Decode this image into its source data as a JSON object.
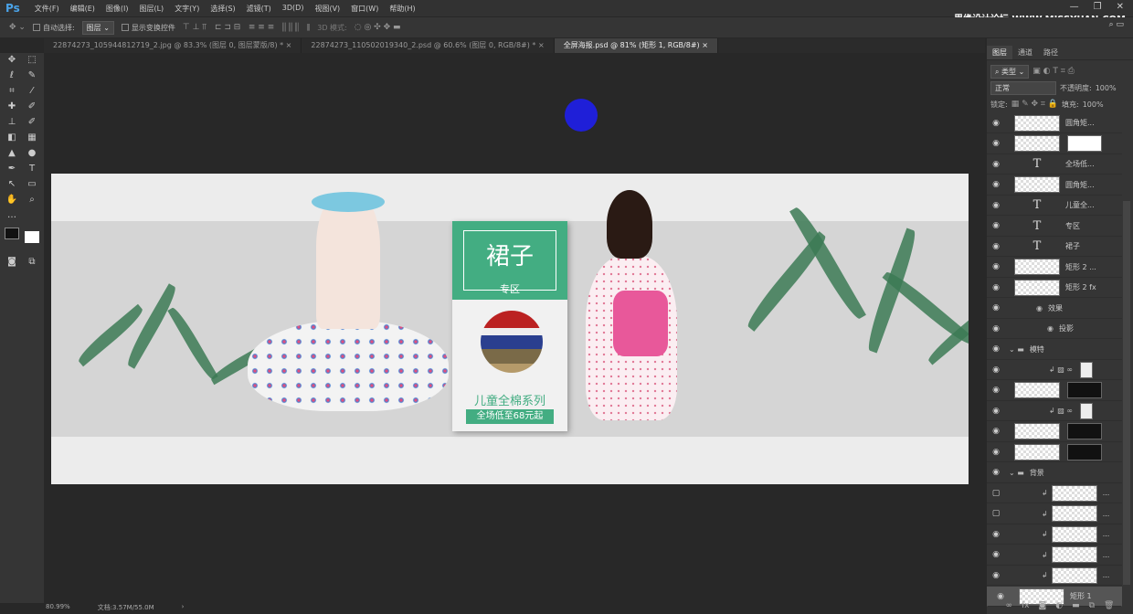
{
  "app": {
    "logo": "Ps",
    "watermark": "思缘设计论坛 WWW.MISSYUAN.COM",
    "window_controls": [
      "—",
      "❐",
      "✕"
    ]
  },
  "menu": [
    "文件(F)",
    "编辑(E)",
    "图像(I)",
    "图层(L)",
    "文字(Y)",
    "选择(S)",
    "滤镜(T)",
    "3D(D)",
    "视图(V)",
    "窗口(W)",
    "帮助(H)"
  ],
  "options": {
    "auto_select_label": "自动选择:",
    "auto_select_value": "图层",
    "show_transform_label": "显示变换控件",
    "mode3d_label": "3D 模式:"
  },
  "tabs": [
    {
      "label": "22874273_105944812719_2.jpg @ 83.3% (图层 0, 图层蒙版/8) *",
      "active": false
    },
    {
      "label": "22874273_110502019340_2.psd @ 60.6% (图层 0, RGB/8#) *",
      "active": false
    },
    {
      "label": "全屏海报.psd @ 81% (矩形 1, RGB/8#)",
      "active": true
    }
  ],
  "banner": {
    "card_title": "裙子",
    "card_subtitle": "专区",
    "series": "儿童全棉系列",
    "price": "全场低至68元起",
    "accent": "#43ad82"
  },
  "panel": {
    "tabs": [
      "图层",
      "通道",
      "路径"
    ],
    "filter_label": "类型",
    "blend_mode": "正常",
    "opacity_label": "不透明度:",
    "opacity": "100%",
    "lock_label": "锁定:",
    "fill_label": "填充:",
    "fill": "100%",
    "layers": [
      {
        "name": "圆角矩...",
        "kind": "smart",
        "visible": true
      },
      {
        "name": "",
        "kind": "mask",
        "visible": true
      },
      {
        "name": "全场低...",
        "kind": "text",
        "visible": true
      },
      {
        "name": "圆角矩...",
        "kind": "smart",
        "visible": true
      },
      {
        "name": "儿童全...",
        "kind": "text",
        "visible": true
      },
      {
        "name": "专区",
        "kind": "text",
        "visible": true
      },
      {
        "name": "裙子",
        "kind": "text",
        "visible": true
      },
      {
        "name": "矩形 2 ...",
        "kind": "smart",
        "visible": true
      },
      {
        "name": "矩形 2 fx",
        "kind": "smart",
        "visible": true
      },
      {
        "name": "效果",
        "kind": "effect",
        "visible": true
      },
      {
        "name": "投影",
        "kind": "effect2",
        "visible": true
      },
      {
        "name": "模特",
        "kind": "group",
        "visible": true
      },
      {
        "name": "",
        "kind": "adjust",
        "visible": true
      },
      {
        "name": "",
        "kind": "mask",
        "visible": true
      },
      {
        "name": "",
        "kind": "adjust",
        "visible": true
      },
      {
        "name": "",
        "kind": "mask",
        "visible": true
      },
      {
        "name": "",
        "kind": "mask",
        "visible": true
      },
      {
        "name": "背景",
        "kind": "group",
        "visible": true
      },
      {
        "name": "...",
        "kind": "clip",
        "visible": false
      },
      {
        "name": "...",
        "kind": "clip",
        "visible": false
      },
      {
        "name": "...",
        "kind": "clip",
        "visible": true
      },
      {
        "name": "...",
        "kind": "clip",
        "visible": true
      },
      {
        "name": "...",
        "kind": "clip",
        "visible": true
      },
      {
        "name": "矩形 1",
        "kind": "selected",
        "visible": true
      }
    ]
  },
  "status": {
    "zoom": "80.99%",
    "doc": "文档:3.57M/55.0M",
    "arrow": "›"
  }
}
